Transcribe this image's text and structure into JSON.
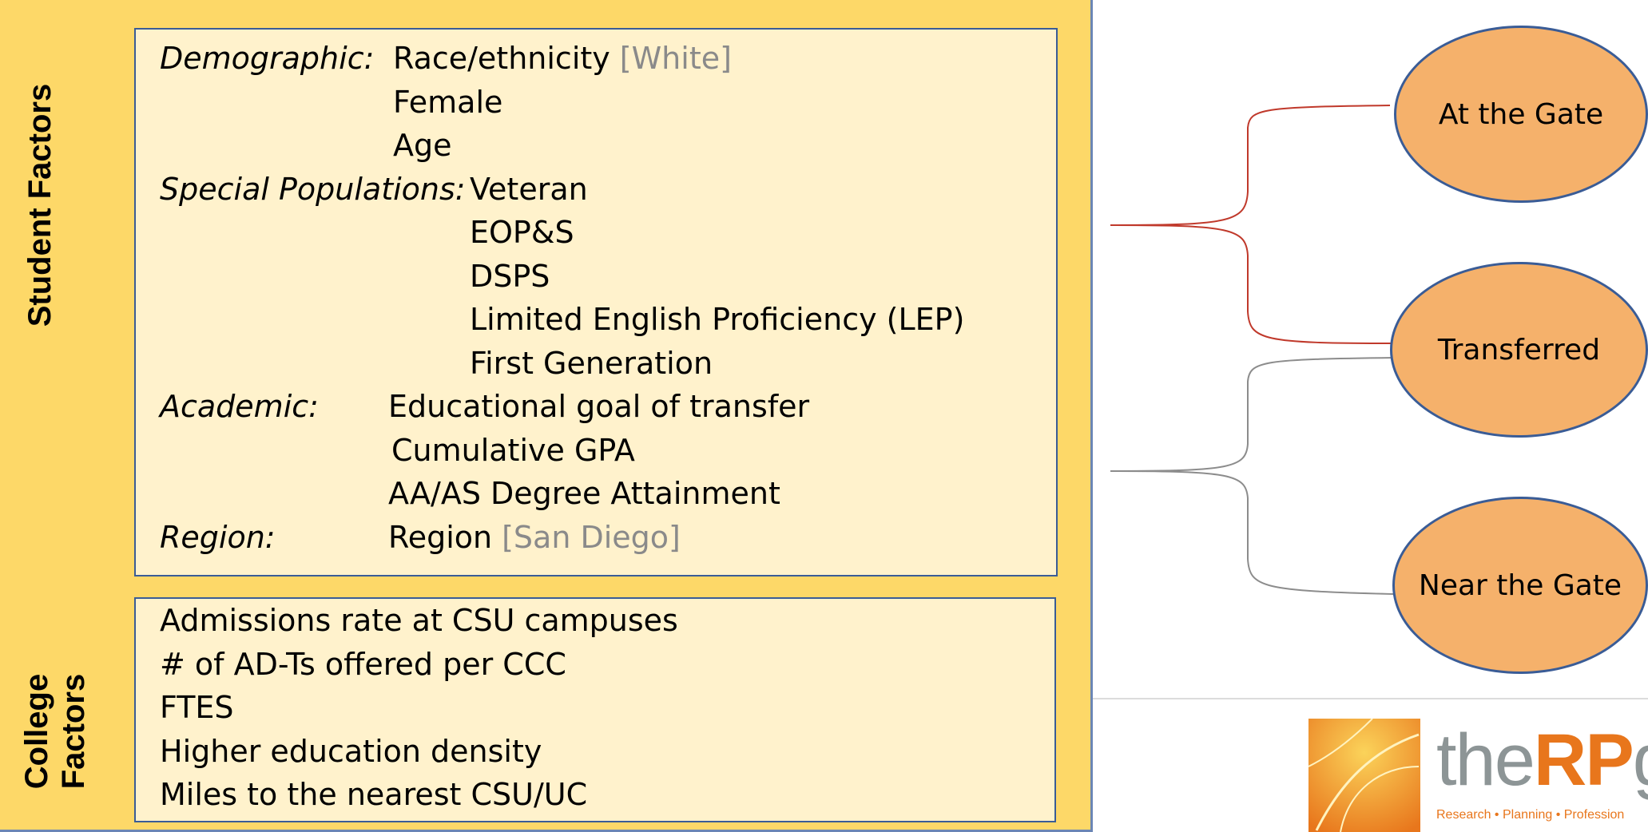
{
  "student_factors": {
    "label": "Student Factors",
    "rows": [
      {
        "category": "Demographic:",
        "value": "Race/ethnicity",
        "ref": "[White]"
      },
      {
        "category": "",
        "value": "Female",
        "ref": ""
      },
      {
        "category": "",
        "value": "Age",
        "ref": ""
      },
      {
        "category": "Special Populations:",
        "value": "Veteran",
        "ref": ""
      },
      {
        "category": "",
        "value": "EOP&S",
        "ref": ""
      },
      {
        "category": "",
        "value": "DSPS",
        "ref": ""
      },
      {
        "category": "",
        "value": "Limited English Proficiency (LEP)",
        "ref": ""
      },
      {
        "category": "",
        "value": "First Generation",
        "ref": ""
      },
      {
        "category": "Academic:",
        "value": "Educational goal of transfer",
        "ref": ""
      },
      {
        "category": "",
        "value": "Cumulative GPA",
        "ref": ""
      },
      {
        "category": "",
        "value": "AA/AS Degree Attainment",
        "ref": ""
      },
      {
        "category": "Region:",
        "value": "Region",
        "ref": "[San Diego]"
      }
    ]
  },
  "college_factors": {
    "label_line1": "College",
    "label_line2": "Factors",
    "items": [
      "Admissions rate at CSU campuses",
      "# of AD-Ts offered per CCC",
      "FTES",
      "Higher education density",
      "Miles to the nearest CSU/UC"
    ]
  },
  "outcomes": [
    "At the Gate",
    "Transferred",
    "Near the Gate"
  ],
  "colors": {
    "outer_fill": "#fdd868",
    "panel_fill": "#fff2cc",
    "panel_border": "#3a5c96",
    "oval_fill": "#f5b16b",
    "red_bracket": "#c0392b",
    "gray_bracket": "#8c8c8c",
    "brand_orange": "#e8761c"
  },
  "logo": {
    "word_prefix": "the",
    "word_bold": "RP",
    "word_suffix": "gr",
    "tagline": "Research • Planning • Profession"
  }
}
